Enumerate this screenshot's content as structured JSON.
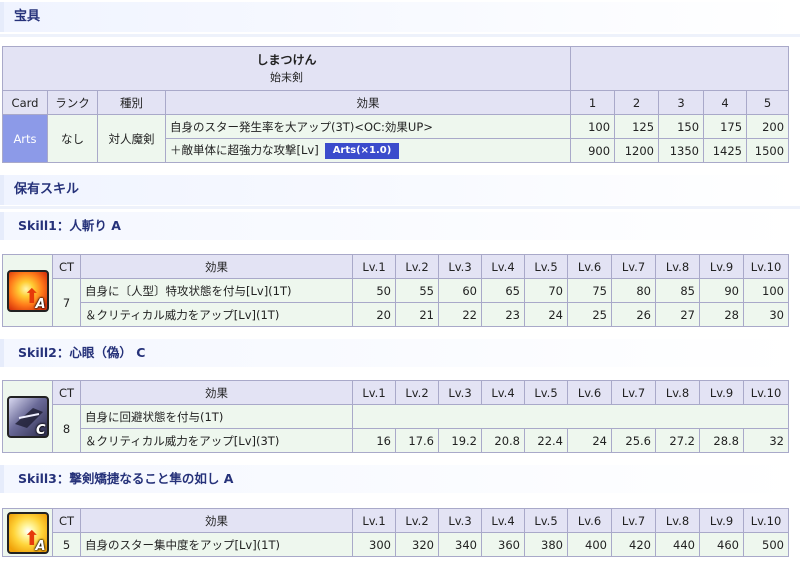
{
  "noble_phantasm": {
    "heading": "宝具",
    "name_ruby": "しまつけん",
    "name": "始末剣",
    "headers": {
      "card": "Card",
      "rank": "ランク",
      "type": "種別",
      "effect": "効果",
      "lv": [
        "1",
        "2",
        "3",
        "4",
        "5"
      ]
    },
    "card": "Arts",
    "rank": "なし",
    "type": "対人魔剣",
    "rows": [
      {
        "effect": "自身のスター発生率を大アップ(3T)<OC:効果UP>",
        "values": [
          "100",
          "125",
          "150",
          "175",
          "200"
        ]
      },
      {
        "effect": "＋敵単体に超強力な攻撃[Lv]",
        "badge": "Arts(×1.0)",
        "values": [
          "900",
          "1200",
          "1350",
          "1425",
          "1500"
        ]
      }
    ]
  },
  "skills_heading": "保有スキル",
  "skill_headers": {
    "ct": "CT",
    "effect": "効果",
    "lv": [
      "Lv.1",
      "Lv.2",
      "Lv.3",
      "Lv.4",
      "Lv.5",
      "Lv.6",
      "Lv.7",
      "Lv.8",
      "Lv.9",
      "Lv.10"
    ]
  },
  "skills": [
    {
      "title": "Skill1：人斬り A",
      "icon": "burst-icon",
      "rank": "A",
      "ct": "7",
      "rows": [
        {
          "effect": "自身に〔人型〕特攻状態を付与[Lv](1T)",
          "values": [
            "50",
            "55",
            "60",
            "65",
            "70",
            "75",
            "80",
            "85",
            "90",
            "100"
          ]
        },
        {
          "effect": "＆クリティカル威力をアップ[Lv](1T)",
          "values": [
            "20",
            "21",
            "22",
            "23",
            "24",
            "25",
            "26",
            "27",
            "28",
            "30"
          ]
        }
      ]
    },
    {
      "title": "Skill2：心眼（偽） C",
      "icon": "eye-icon",
      "rank": "C",
      "ct": "8",
      "rows": [
        {
          "effect": "自身に回避状態を付与(1T)",
          "values": []
        },
        {
          "effect": "＆クリティカル威力をアップ[Lv](3T)",
          "values": [
            "16",
            "17.6",
            "19.2",
            "20.8",
            "22.4",
            "24",
            "25.6",
            "27.2",
            "28.8",
            "32"
          ]
        }
      ]
    },
    {
      "title": "Skill3：撃剣矯捷なること隼の如し A",
      "icon": "star-icon",
      "rank": "A",
      "ct": "5",
      "rows": [
        {
          "effect": "自身のスター集中度をアップ[Lv](1T)",
          "values": [
            "300",
            "320",
            "340",
            "360",
            "380",
            "400",
            "420",
            "440",
            "460",
            "500"
          ]
        }
      ]
    }
  ],
  "colors": {
    "header_bg": "#e3e3f4",
    "body_bg": "#eef7ee",
    "arts": "#8c9ae8",
    "badge": "#3b4ccc",
    "heading_text": "#26327a"
  }
}
